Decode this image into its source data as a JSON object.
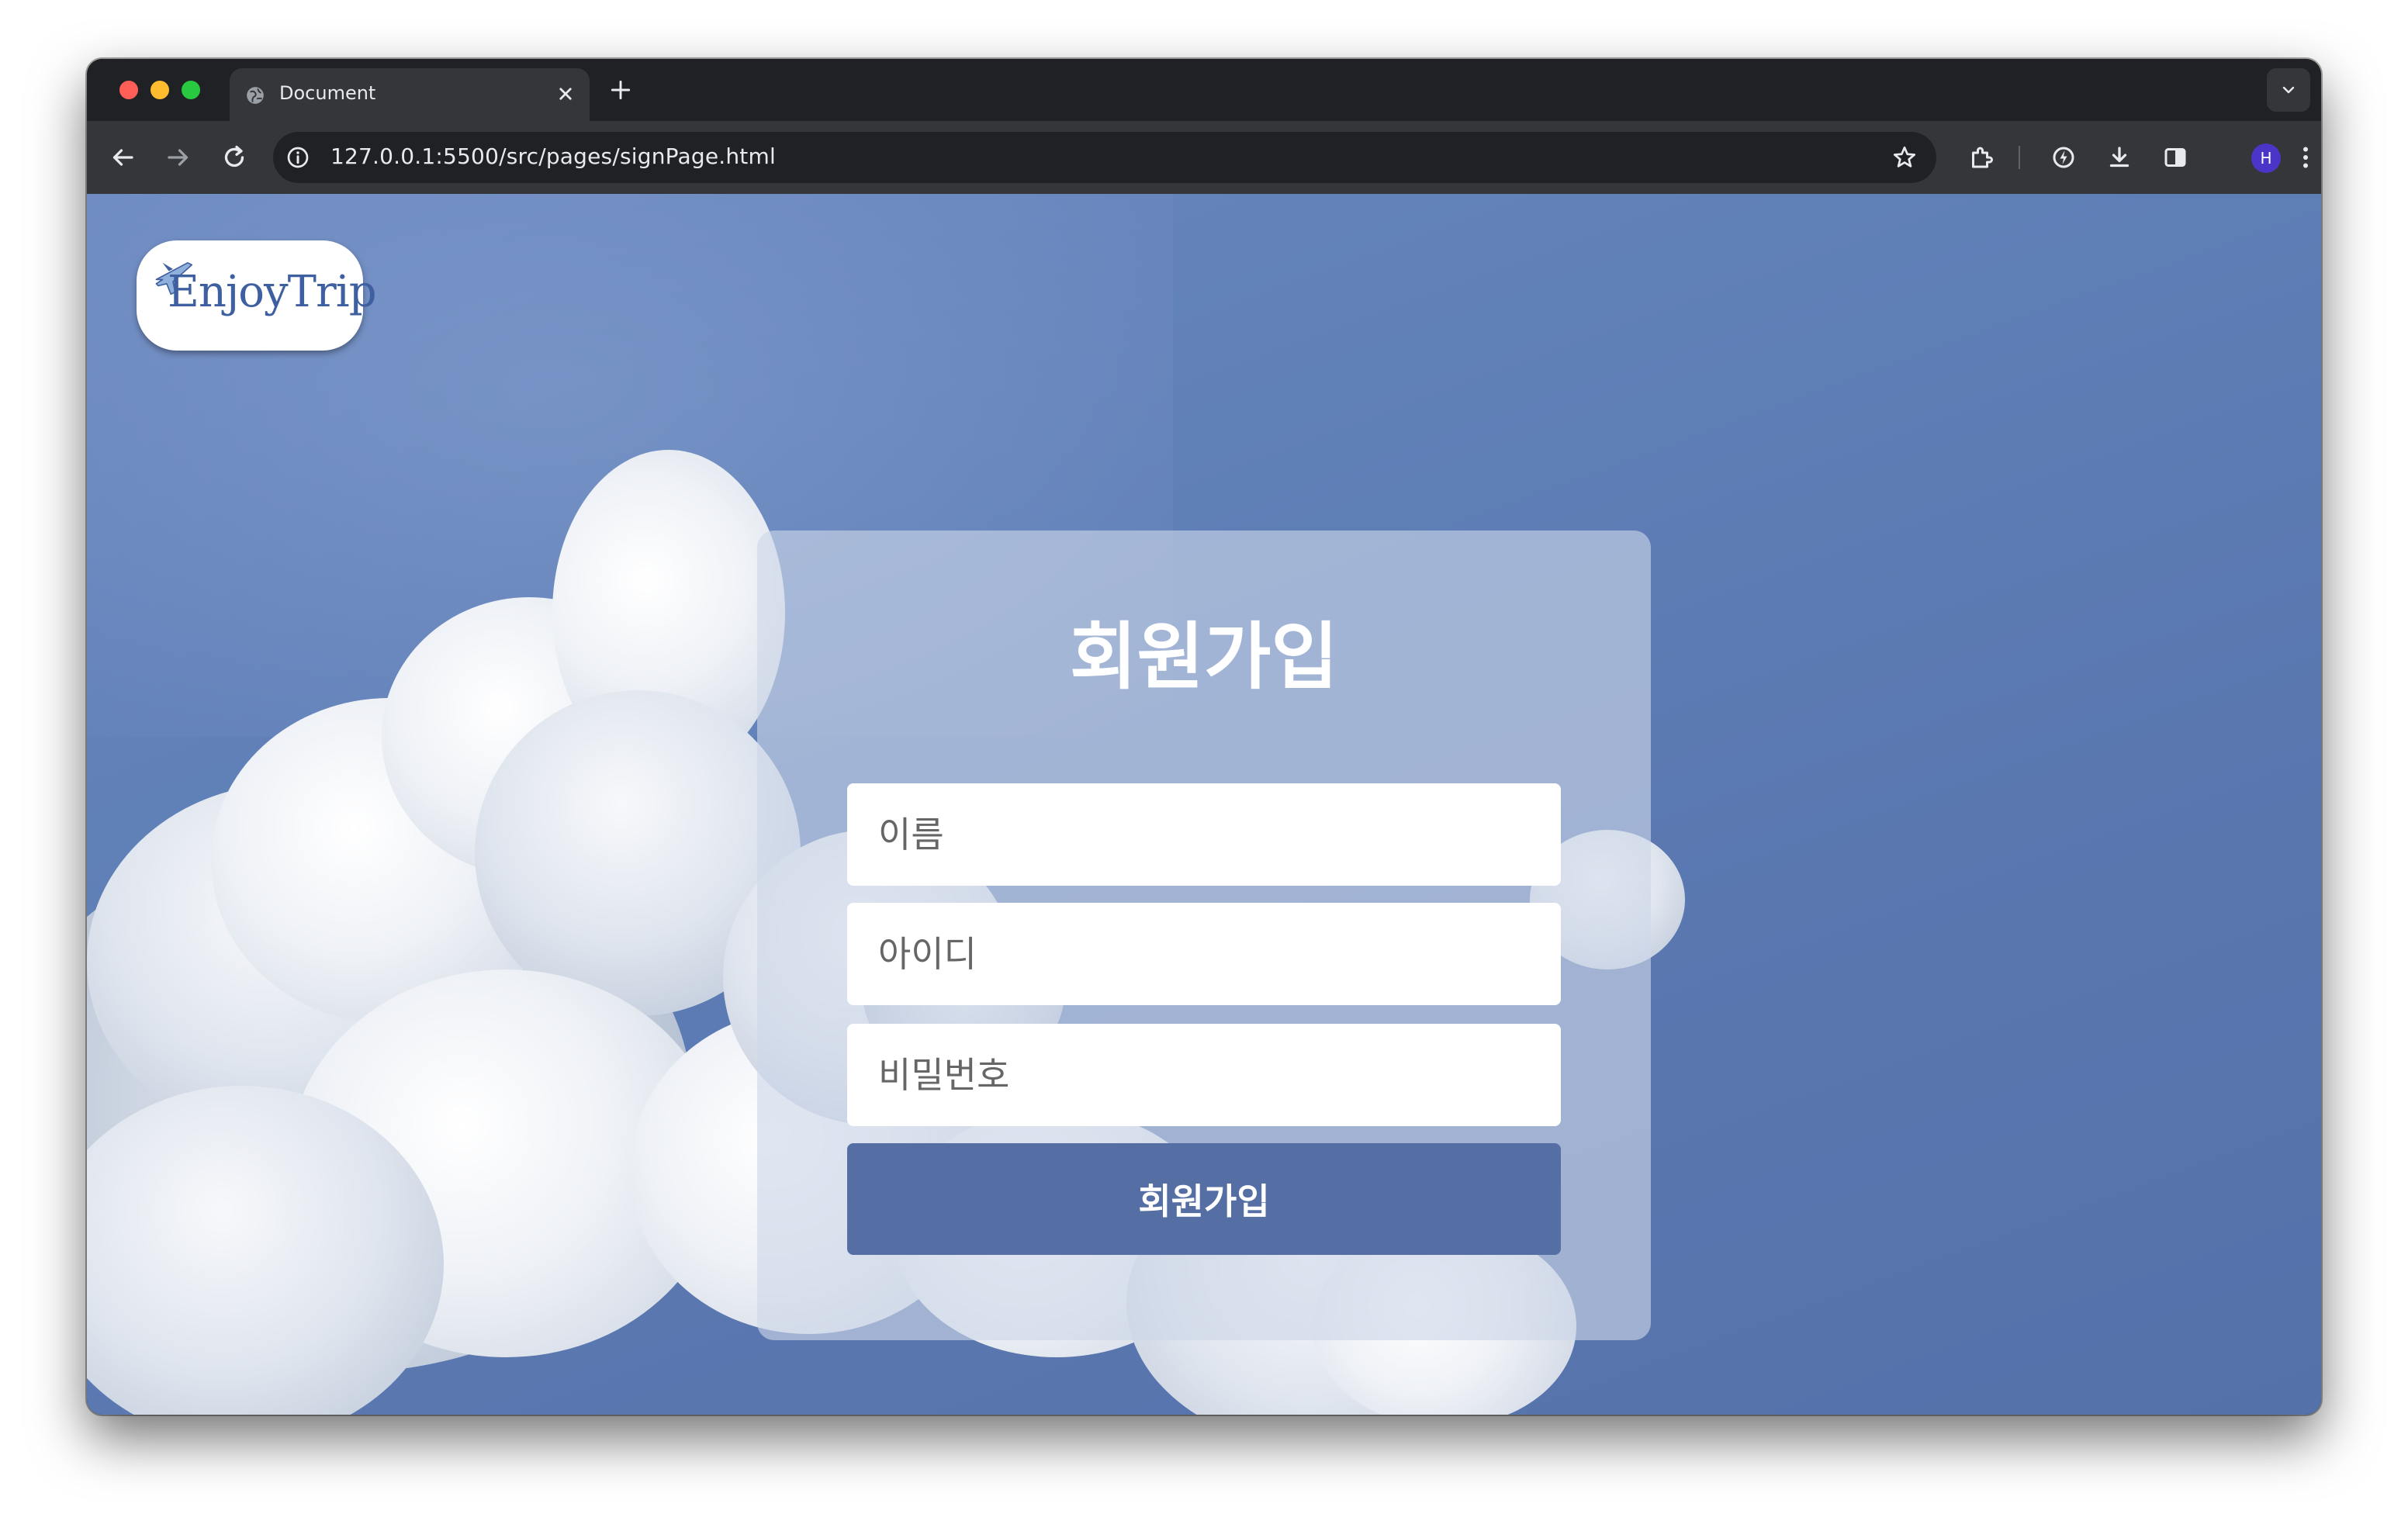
{
  "browser": {
    "tab": {
      "title": "Document"
    },
    "address_bar": {
      "url": "127.0.0.1:5500/src/pages/signPage.html"
    },
    "profile": {
      "initial": "H",
      "color": "#4a35c8"
    }
  },
  "page": {
    "logo": {
      "text": "EnjoyTrip"
    },
    "signup_form": {
      "title": "회원가입",
      "name_field": {
        "placeholder": "이름",
        "value": ""
      },
      "id_field": {
        "placeholder": "아이디",
        "value": ""
      },
      "password_field": {
        "placeholder": "비밀번호",
        "value": ""
      },
      "submit_label": "회원가입",
      "submit_color": "#556fa4"
    }
  }
}
